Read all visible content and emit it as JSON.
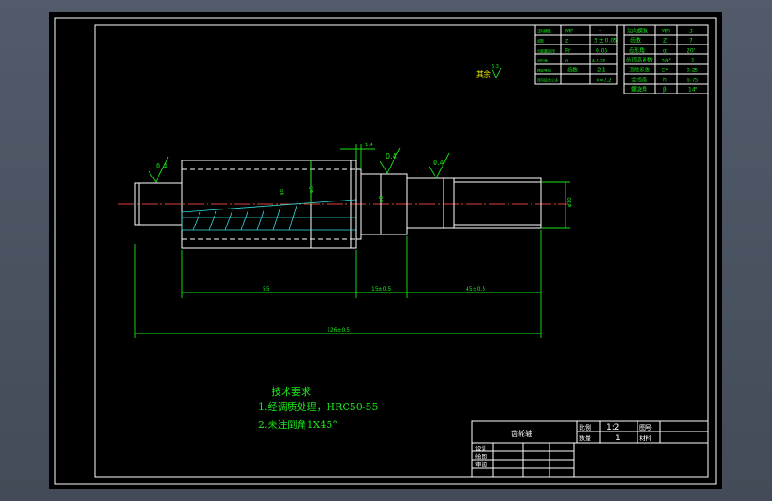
{
  "params_left": [
    [
      "法向模数",
      "Mn",
      "-"
    ],
    [
      "齿数",
      "z",
      "3 ± 0.05"
    ],
    [
      "分度圆直径",
      "Fr",
      "0.05"
    ],
    [
      "齿形角",
      "α",
      "4-7-28"
    ],
    [
      "精度等级",
      "齿数",
      "21"
    ],
    [
      "径向综合公差",
      "",
      "x=2.2"
    ]
  ],
  "params_right": [
    [
      "法向模数",
      "Mn",
      "3"
    ],
    [
      "齿数",
      "Z",
      "7"
    ],
    [
      "齿形角",
      "α",
      "20°"
    ],
    [
      "齿顶高系数",
      "ha*",
      "1"
    ],
    [
      "顶隙系数",
      "C*",
      "0.25"
    ],
    [
      "全齿高",
      "h",
      "6.75"
    ],
    [
      "螺旋角",
      "β",
      "14°"
    ]
  ],
  "surface_note": "其余",
  "roughness": {
    "other": "6.3",
    "left": "0.4",
    "middle": "0.4",
    "right": "0.4"
  },
  "dims": {
    "shoulder": "1.4",
    "len_gear": "55",
    "len_mid": "15±0.5",
    "len_right": "45±0.5",
    "total": "126±0.5",
    "dia_gear": "φ8",
    "dia_inner": "φ5",
    "dia_mid": "φ8",
    "dia_right": "φ10"
  },
  "notes": {
    "title": "技术要求",
    "line1": "1.经调质处理，HRC50-55",
    "line2": "2.未注倒角1X45°"
  },
  "title_block": {
    "name": "齿轮轴",
    "scale_label": "比例",
    "scale_value": "1:2",
    "qty_label": "数量",
    "qty_value": "1",
    "drawing_no_label": "图号",
    "material_label": "材料",
    "design_label": "设计",
    "draw_label": "绘图",
    "review_label": "审阅"
  }
}
